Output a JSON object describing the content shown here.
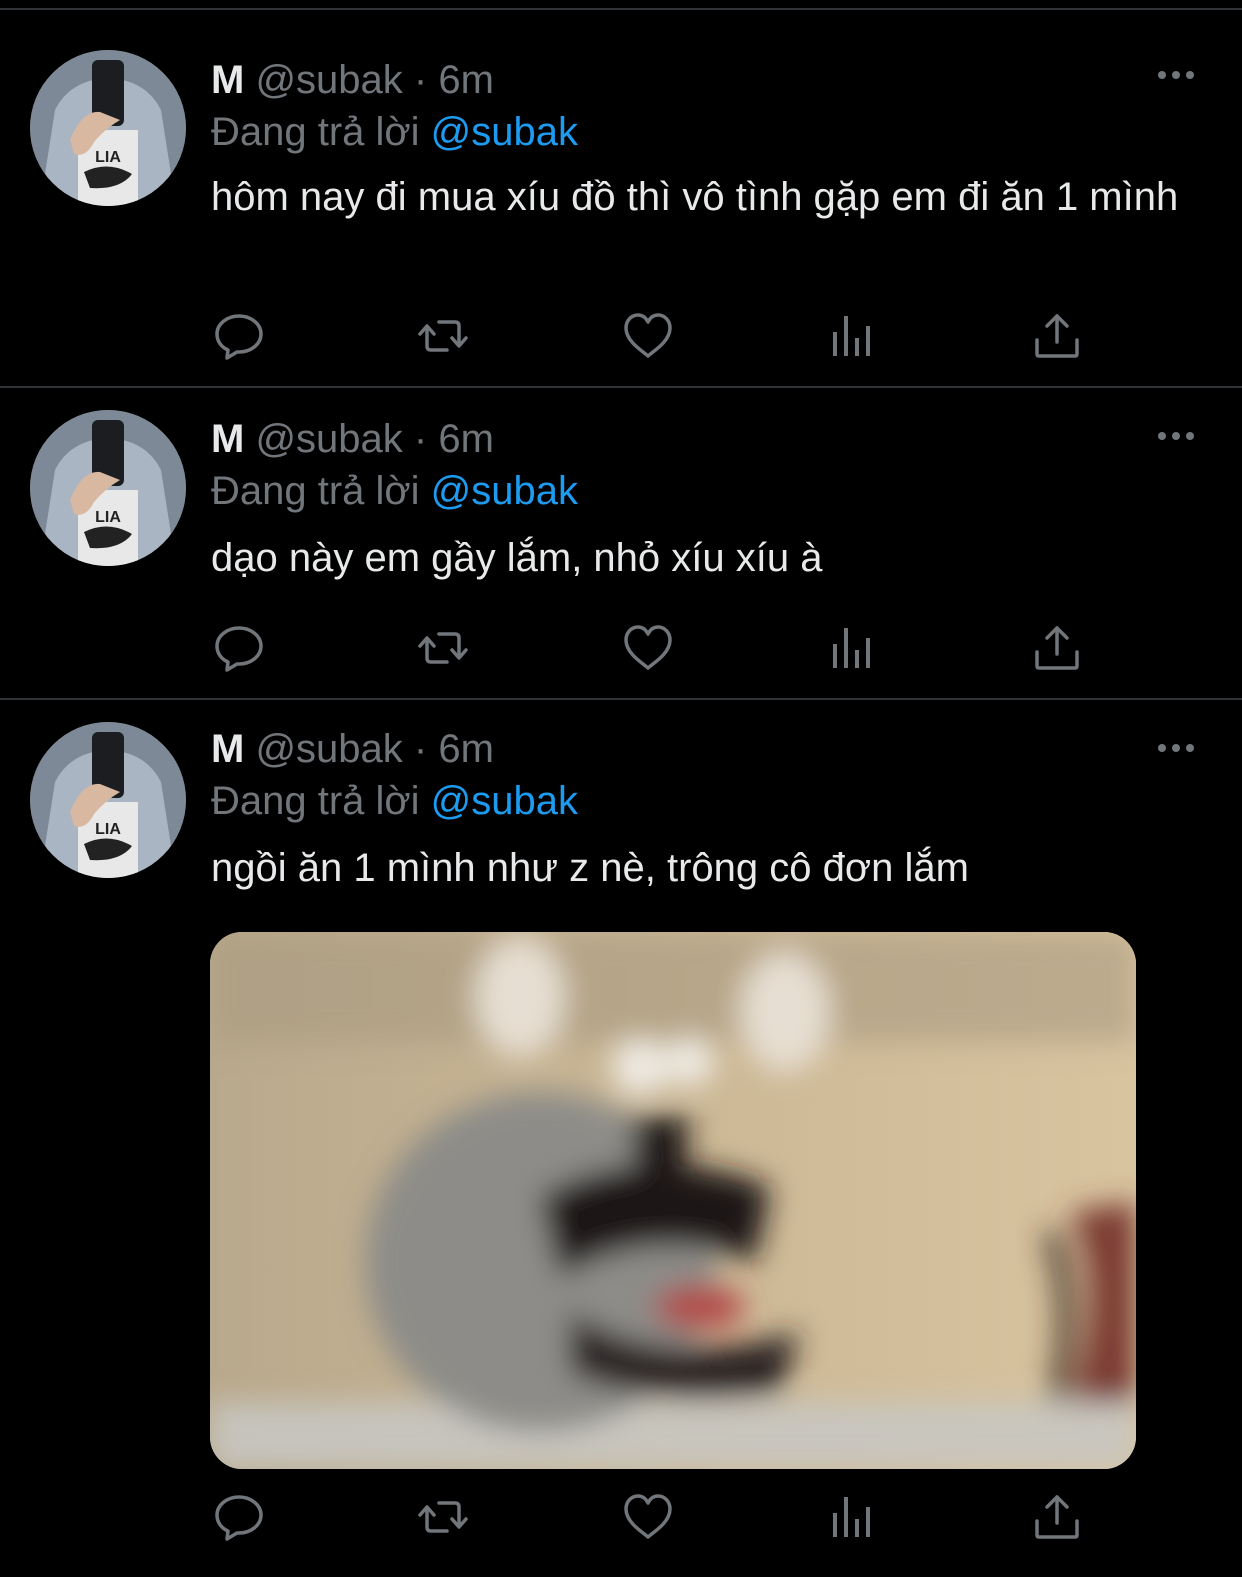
{
  "tweets": [
    {
      "name": "M",
      "handle": "@subak",
      "dot": "·",
      "time": "6m",
      "reply_prefix": "Đang trả lời",
      "reply_to": "@subak",
      "text": "hôm nay đi mua xíu đồ thì vô tình gặp em đi ăn 1 mình",
      "has_media": false
    },
    {
      "name": "M",
      "handle": "@subak",
      "dot": "·",
      "time": "6m",
      "reply_prefix": "Đang trả lời",
      "reply_to": "@subak",
      "text": "dạo này em gầy lắm, nhỏ xíu xíu à",
      "has_media": false
    },
    {
      "name": "M",
      "handle": "@subak",
      "dot": "·",
      "time": "6m",
      "reply_prefix": "Đang trả lời",
      "reply_to": "@subak",
      "text": "ngồi ăn 1 mình như z nè, trông cô đơn lắm",
      "has_media": true
    }
  ],
  "icons": {
    "more": "more-horizontal-icon",
    "reply": "reply-icon",
    "retweet": "retweet-icon",
    "like": "like-icon",
    "views": "views-icon",
    "share": "share-icon"
  },
  "colors": {
    "background": "#000000",
    "text_primary": "#e7e9ea",
    "text_secondary": "#71767b",
    "link": "#1d9bf0",
    "divider": "#2f3336"
  }
}
